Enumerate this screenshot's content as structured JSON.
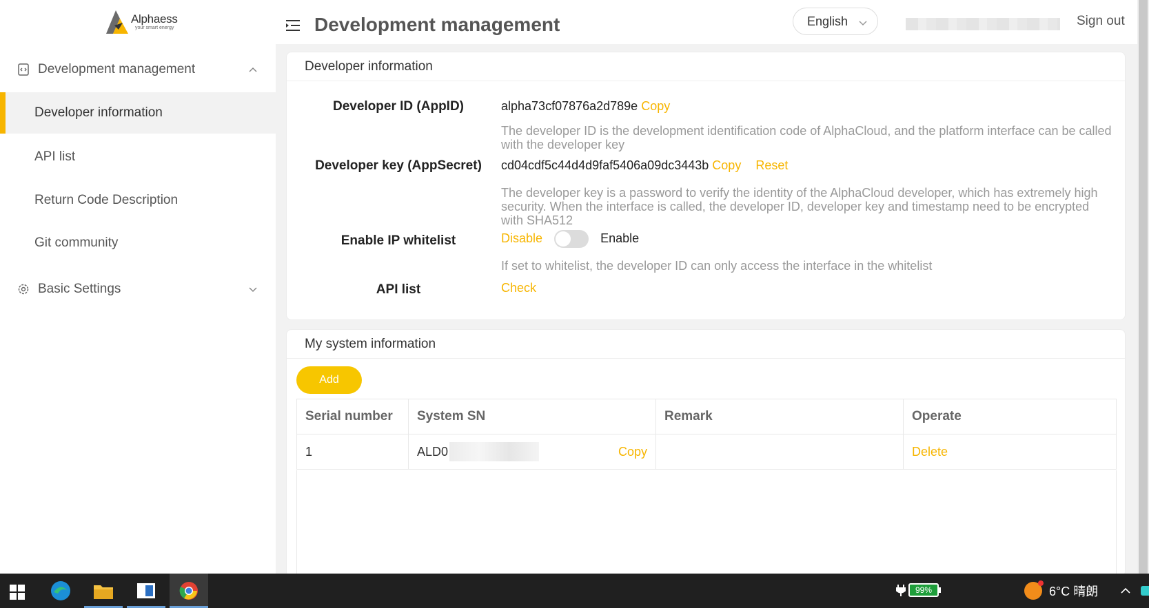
{
  "app": {
    "logo_name": "Alphaess",
    "logo_tagline": "your smart energy"
  },
  "sidebar": {
    "group_dev": "Development management",
    "items": [
      {
        "label": "Developer information"
      },
      {
        "label": "API list"
      },
      {
        "label": "Return Code Description"
      },
      {
        "label": "Git community"
      }
    ],
    "group_basic": "Basic Settings"
  },
  "header": {
    "title": "Development management",
    "language": "English",
    "sign_out": "Sign out"
  },
  "developer_info": {
    "card_title": "Developer information",
    "appid_label": "Developer ID (AppID)",
    "appid_value": "alpha73cf07876a2d789e",
    "copy": "Copy",
    "appid_desc": "The developer ID is the development identification code of AlphaCloud, and the platform interface can be called with the developer key",
    "key_label": "Developer key (AppSecret)",
    "key_value": "cd04cdf5c44d4d9faf5406a09dc3443b",
    "reset": "Reset",
    "key_desc": "The developer key is a password to verify the identity of the AlphaCloud developer, which has extremely high security. When the interface is called, the developer ID, developer key and timestamp need to be encrypted with SHA512",
    "whitelist_label": "Enable IP whitelist",
    "disable": "Disable",
    "enable": "Enable",
    "whitelist_enabled": false,
    "whitelist_desc": "If set to whitelist, the developer ID can only access the interface in the whitelist",
    "api_list_label": "API list",
    "check": "Check"
  },
  "system_info": {
    "card_title": "My system information",
    "add": "Add",
    "columns": [
      "Serial number",
      "System SN",
      "Remark",
      "Operate"
    ],
    "rows": [
      {
        "serial": "1",
        "sn_prefix": "ALD0",
        "copy": "Copy",
        "remark": "",
        "operate": "Delete"
      }
    ]
  },
  "taskbar": {
    "battery": "99%",
    "weather": "6°C  晴朗"
  },
  "colors": {
    "accent": "#f7b500",
    "button": "#f7c600"
  }
}
